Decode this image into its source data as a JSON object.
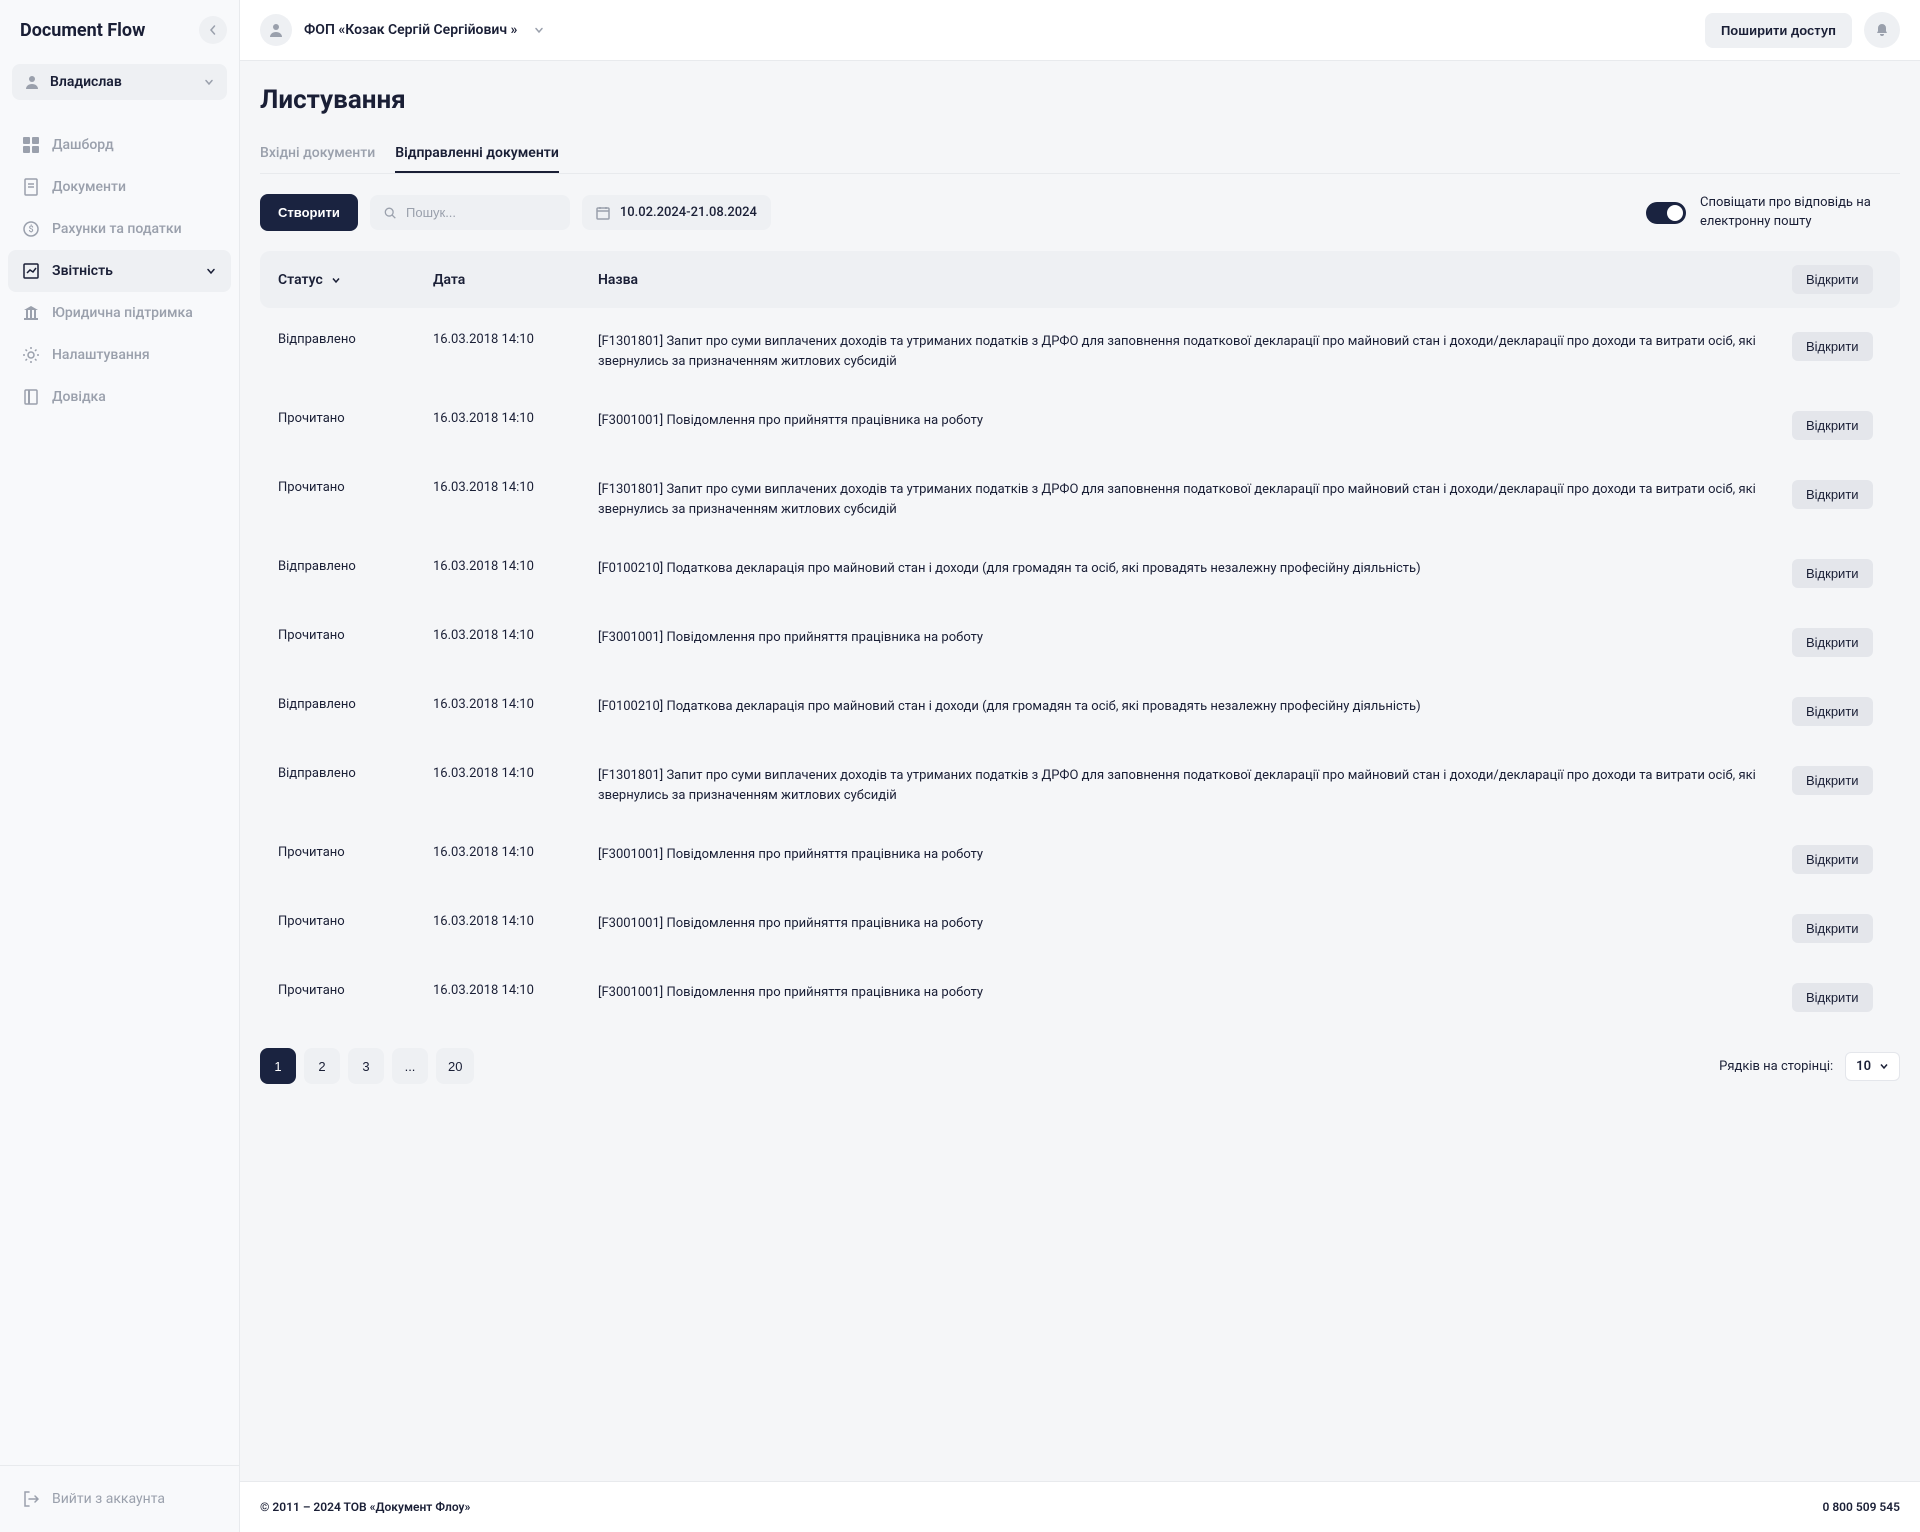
{
  "sidebar": {
    "logo": "Document Flow",
    "user": "Владислав",
    "nav": [
      {
        "label": "Дашборд",
        "active": false
      },
      {
        "label": "Документи",
        "active": false
      },
      {
        "label": "Рахунки та податки",
        "active": false
      },
      {
        "label": "Звітність",
        "active": true
      },
      {
        "label": "Юридична підтримка",
        "active": false
      },
      {
        "label": "Налаштування",
        "active": false
      },
      {
        "label": "Довідка",
        "active": false
      }
    ],
    "logout": "Вийти з аккаунта"
  },
  "topbar": {
    "org": "ФОП «Козак Сергій Сергійович »",
    "share": "Поширити доступ"
  },
  "page": {
    "title": "Листування",
    "tabs": [
      {
        "label": "Вхідні документи",
        "active": false
      },
      {
        "label": "Відправленні документи",
        "active": true
      }
    ],
    "create": "Створити",
    "search_placeholder": "Пошук...",
    "date_range": "10.02.2024-21.08.2024",
    "toggle_label": "Сповіщати про відповідь на електронну пошту",
    "columns": {
      "status": "Статус",
      "date": "Дата",
      "title": "Назва",
      "open": "Відкрити"
    },
    "rows": [
      {
        "status": "Відправлено",
        "date": "16.03.2018 14:10",
        "title": "[F1301801] Запит про суми виплачених доходів та утриманих податків з ДРФО для заповнення податкової декларації про майновий стан і доходи/декларації про доходи та витрати осіб, які звернулись за призначенням житлових субсидій"
      },
      {
        "status": "Прочитано",
        "date": "16.03.2018 14:10",
        "title": "[F3001001] Повідомлення про прийняття працівника на роботу"
      },
      {
        "status": "Прочитано",
        "date": "16.03.2018 14:10",
        "title": "[F1301801] Запит про суми виплачених доходів та утриманих податків з ДРФО для заповнення податкової декларації про майновий стан і доходи/декларації про доходи та витрати осіб, які звернулись за призначенням житлових субсидій"
      },
      {
        "status": "Відправлено",
        "date": "16.03.2018 14:10",
        "title": "[F0100210] Податкова декларація про майновий стан і доходи (для громадян та осіб, які провадять незалежну професійну діяльність)"
      },
      {
        "status": "Прочитано",
        "date": "16.03.2018 14:10",
        "title": "[F3001001] Повідомлення про прийняття працівника на роботу"
      },
      {
        "status": "Відправлено",
        "date": "16.03.2018 14:10",
        "title": "[F0100210] Податкова декларація про майновий стан і доходи (для громадян та осіб, які провадять незалежну професійну діяльність)"
      },
      {
        "status": "Відправлено",
        "date": "16.03.2018 14:10",
        "title": "[F1301801] Запит про суми виплачених доходів та утриманих податків з ДРФО для заповнення податкової декларації про майновий стан і доходи/декларації про доходи та витрати осіб, які звернулись за призначенням житлових субсидій"
      },
      {
        "status": "Прочитано",
        "date": "16.03.2018 14:10",
        "title": "[F3001001] Повідомлення про прийняття працівника на роботу"
      },
      {
        "status": "Прочитано",
        "date": "16.03.2018 14:10",
        "title": "[F3001001] Повідомлення про прийняття працівника на роботу"
      },
      {
        "status": "Прочитано",
        "date": "16.03.2018 14:10",
        "title": "[F3001001] Повідомлення про прийняття працівника на роботу"
      }
    ],
    "open_label": "Відкрити",
    "pages": [
      "1",
      "2",
      "3",
      "...",
      "20"
    ],
    "rows_per_label": "Рядків на сторінці:",
    "rows_per_value": "10"
  },
  "footer": {
    "copyright": "© 2011 – 2024 ТОВ «Документ Флоу»",
    "phone": "0 800 509 545"
  }
}
